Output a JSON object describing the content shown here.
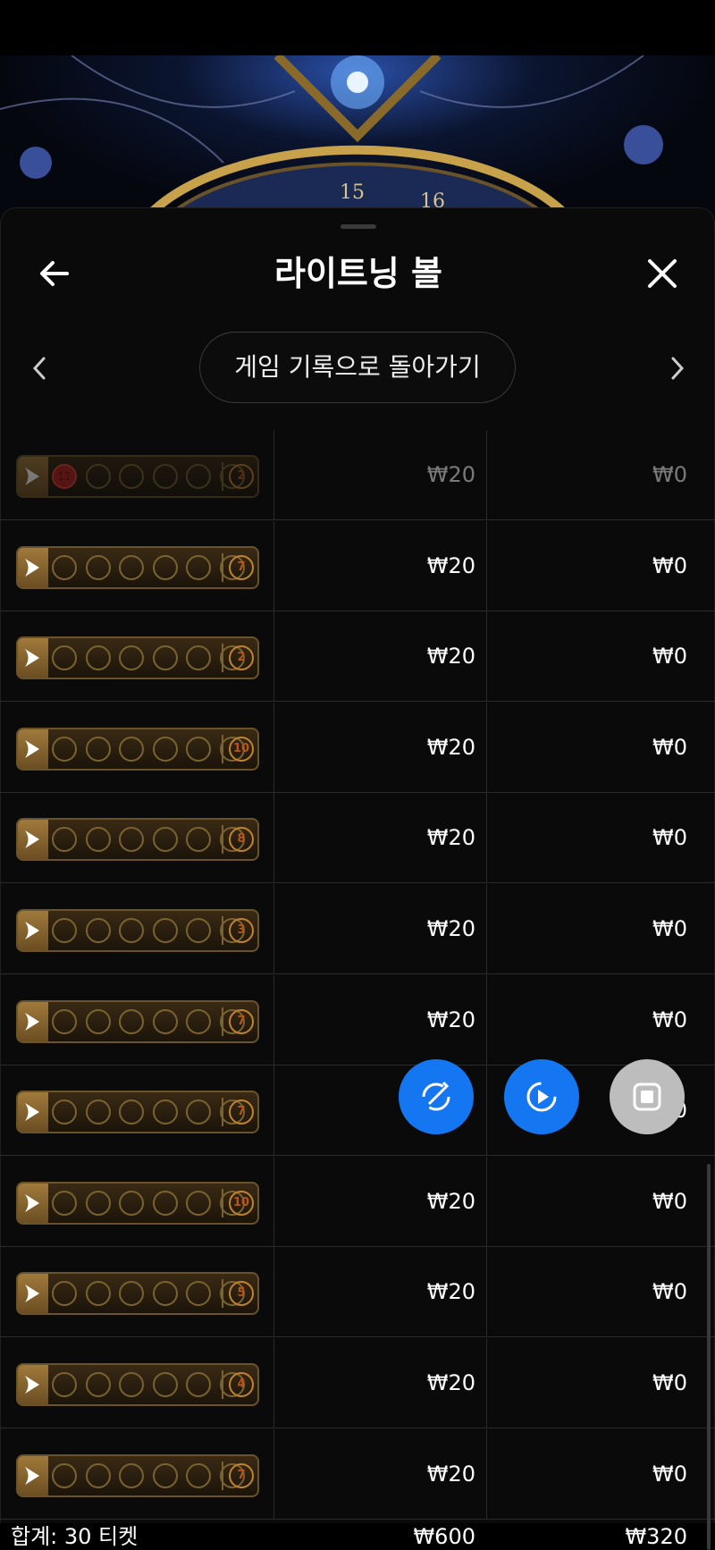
{
  "header": {
    "title": "라이트닝 볼",
    "back_icon": "arrow-left-icon",
    "close_icon": "close-icon"
  },
  "nav": {
    "back_to_history": "게임 기록으로 돌아가기",
    "prev_icon": "chevron-left-icon",
    "next_icon": "chevron-right-icon"
  },
  "hero": {
    "visible_numbers": [
      "15",
      "16"
    ]
  },
  "rows": [
    {
      "balls": [
        "11",
        "",
        "",
        "",
        "",
        ""
      ],
      "bonus": "2",
      "bet": "₩20",
      "win": "₩0",
      "faded": true,
      "red_first": true
    },
    {
      "balls": [
        "",
        "",
        "",
        "",
        "",
        ""
      ],
      "bonus": "7",
      "bet": "₩20",
      "win": "₩0"
    },
    {
      "balls": [
        "",
        "",
        "",
        "",
        "",
        ""
      ],
      "bonus": "2",
      "bet": "₩20",
      "win": "₩0"
    },
    {
      "balls": [
        "",
        "",
        "",
        "",
        "",
        ""
      ],
      "bonus": "10",
      "bet": "₩20",
      "win": "₩0"
    },
    {
      "balls": [
        "",
        "",
        "",
        "",
        "",
        ""
      ],
      "bonus": "8",
      "bet": "₩20",
      "win": "₩0"
    },
    {
      "balls": [
        "",
        "",
        "",
        "",
        "",
        ""
      ],
      "bonus": "3",
      "bet": "₩20",
      "win": "₩0"
    },
    {
      "balls": [
        "",
        "",
        "",
        "",
        "",
        ""
      ],
      "bonus": "7",
      "bet": "₩20",
      "win": "₩0"
    },
    {
      "balls": [
        "",
        "",
        "",
        "",
        "",
        ""
      ],
      "bonus": "7",
      "bet": "",
      "win": "",
      "partial_win": "0"
    },
    {
      "balls": [
        "",
        "",
        "",
        "",
        "",
        ""
      ],
      "bonus": "10",
      "bet": "₩20",
      "win": "₩0"
    },
    {
      "balls": [
        "",
        "",
        "",
        "",
        "",
        ""
      ],
      "bonus": "5",
      "bet": "₩20",
      "win": "₩0"
    },
    {
      "balls": [
        "",
        "",
        "",
        "",
        "",
        ""
      ],
      "bonus": "4",
      "bet": "₩20",
      "win": "₩0"
    },
    {
      "balls": [
        "",
        "",
        "",
        "",
        "",
        ""
      ],
      "bonus": "7",
      "bet": "₩20",
      "win": "₩0"
    }
  ],
  "footer": {
    "total_label": "합계: 30 티켓",
    "total_bet": "₩600",
    "total_win": "₩320"
  },
  "fabs": [
    {
      "icon": "rotate-icon"
    },
    {
      "icon": "play-record-icon"
    },
    {
      "icon": "stop-icon"
    }
  ],
  "colors": {
    "accent_blue": "#1476f0",
    "background": "#0a0a0a",
    "ticket_gold": "#7a6330",
    "bonus_orange": "#b8561c"
  }
}
